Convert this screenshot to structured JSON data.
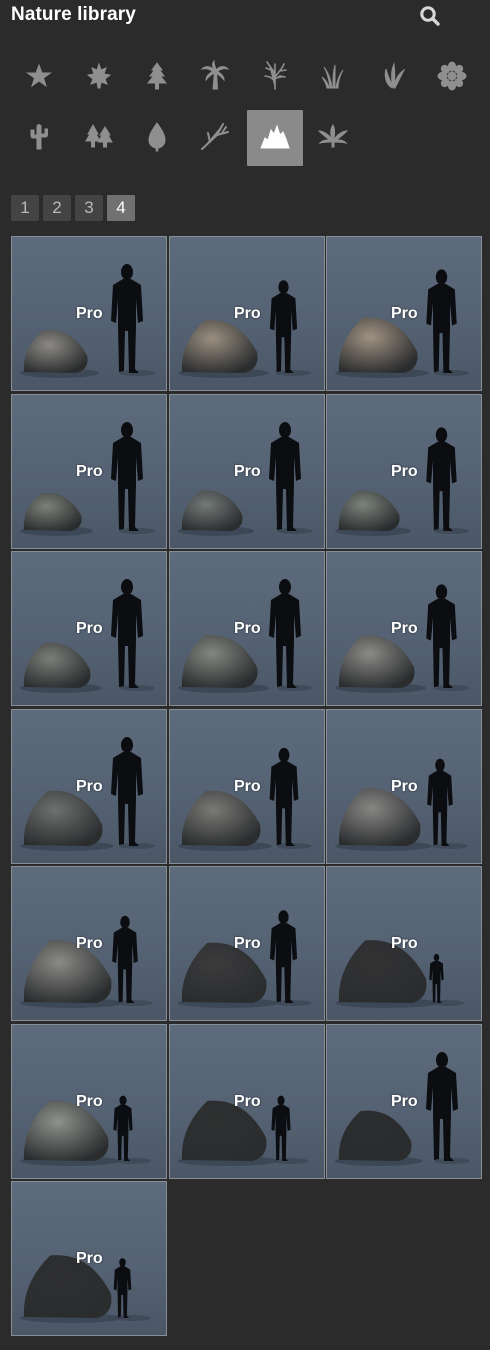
{
  "header": {
    "title": "Nature library",
    "search_icon": "search-icon"
  },
  "categories": [
    {
      "name": "favorites",
      "icon": "star-icon",
      "active": false
    },
    {
      "name": "leaf",
      "icon": "maple-leaf-icon",
      "active": false
    },
    {
      "name": "conifer",
      "icon": "pine-tree-icon",
      "active": false
    },
    {
      "name": "palm",
      "icon": "palm-tree-icon",
      "active": false
    },
    {
      "name": "bare-tree",
      "icon": "bare-tree-icon",
      "active": false
    },
    {
      "name": "grass",
      "icon": "grass-icon",
      "active": false
    },
    {
      "name": "plant",
      "icon": "plant-icon",
      "active": false
    },
    {
      "name": "flower",
      "icon": "flower-icon",
      "active": false
    },
    {
      "name": "cactus",
      "icon": "cactus-icon",
      "active": false
    },
    {
      "name": "forest",
      "icon": "forest-icon",
      "active": false
    },
    {
      "name": "leaf-drop",
      "icon": "leaf-drop-icon",
      "active": false
    },
    {
      "name": "branch",
      "icon": "branch-icon",
      "active": false
    },
    {
      "name": "rocks",
      "icon": "rocks-icon",
      "active": true
    },
    {
      "name": "fern",
      "icon": "fern-icon",
      "active": false
    }
  ],
  "pagination": {
    "pages": [
      "1",
      "2",
      "3",
      "4"
    ],
    "current": "4"
  },
  "tiles": [
    {
      "badge": "Pro",
      "rock_tone": "#8c8a85",
      "rock_size": 0.55,
      "figure_scale": 1.0
    },
    {
      "badge": "Pro",
      "rock_tone": "#9a8f80",
      "rock_size": 0.75,
      "figure_scale": 0.85
    },
    {
      "badge": "Pro",
      "rock_tone": "#a09282",
      "rock_size": 0.8,
      "figure_scale": 0.95
    },
    {
      "badge": "Pro",
      "rock_tone": "#7d8278",
      "rock_size": 0.45,
      "figure_scale": 1.0
    },
    {
      "badge": "Pro",
      "rock_tone": "#737a78",
      "rock_size": 0.5,
      "figure_scale": 1.0
    },
    {
      "badge": "Pro",
      "rock_tone": "#7c837c",
      "rock_size": 0.5,
      "figure_scale": 0.95
    },
    {
      "badge": "Pro",
      "rock_tone": "#7b7f79",
      "rock_size": 0.6,
      "figure_scale": 1.0
    },
    {
      "badge": "Pro",
      "rock_tone": "#838780",
      "rock_size": 0.75,
      "figure_scale": 1.0
    },
    {
      "badge": "Pro",
      "rock_tone": "#8b8b87",
      "rock_size": 0.75,
      "figure_scale": 0.95
    },
    {
      "badge": "Pro",
      "rock_tone": "#6e716e",
      "rock_size": 0.8,
      "figure_scale": 1.0
    },
    {
      "badge": "Pro",
      "rock_tone": "#7a7a76",
      "rock_size": 0.8,
      "figure_scale": 0.9
    },
    {
      "badge": "Pro",
      "rock_tone": "#878684",
      "rock_size": 0.85,
      "figure_scale": 0.8
    },
    {
      "badge": "Pro",
      "rock_tone": "#8a8a86",
      "rock_size": 0.95,
      "figure_scale": 0.8
    },
    {
      "badge": "Pro",
      "rock_tone": "#3b3b3c",
      "rock_size": 0.9,
      "figure_scale": 0.85
    },
    {
      "badge": "Pro",
      "rock_tone": "#333334",
      "rock_size": 0.95,
      "figure_scale": 0.45
    },
    {
      "badge": "Pro",
      "rock_tone": "#8f918c",
      "rock_size": 0.9,
      "figure_scale": 0.6
    },
    {
      "badge": "Pro",
      "rock_tone": "#2f3031",
      "rock_size": 0.9,
      "figure_scale": 0.6
    },
    {
      "badge": "Pro",
      "rock_tone": "#2c2d2e",
      "rock_size": 0.7,
      "figure_scale": 1.0
    },
    {
      "badge": "Pro",
      "rock_tone": "#2e2f30",
      "rock_size": 0.95,
      "figure_scale": 0.55
    }
  ]
}
